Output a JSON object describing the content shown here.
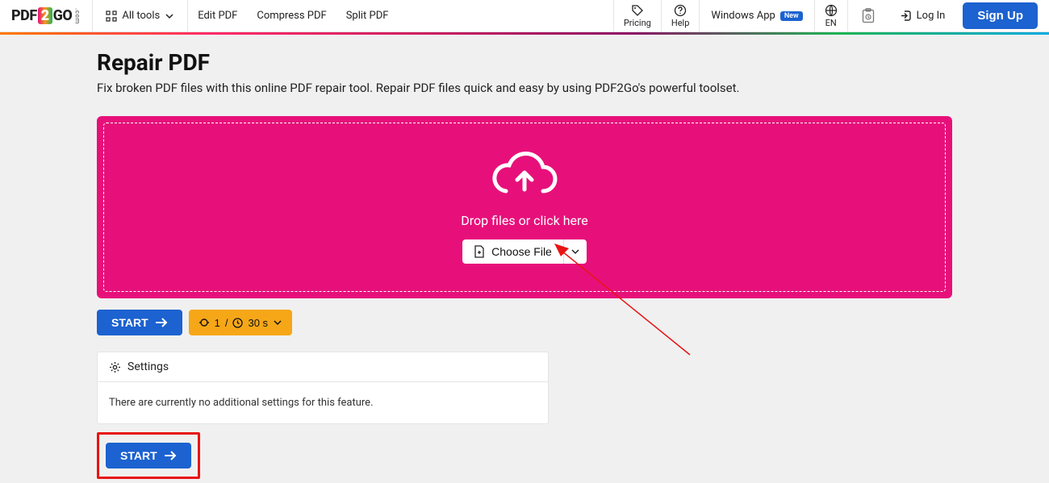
{
  "nav": {
    "logo_pdf": "PDF",
    "logo_two": "2",
    "logo_go": "GO",
    "logo_com": ".com",
    "all_tools": "All tools",
    "edit": "Edit PDF",
    "compress": "Compress PDF",
    "split": "Split PDF",
    "pricing": "Pricing",
    "help": "Help",
    "windows_app": "Windows App",
    "badge_new": "New",
    "lang": "EN",
    "login": "Log In",
    "signup": "Sign Up"
  },
  "page": {
    "title": "Repair PDF",
    "subtitle": "Fix broken PDF files with this online PDF repair tool. Repair PDF files quick and easy by using PDF2Go's powerful toolset."
  },
  "dropzone": {
    "text": "Drop files or click here",
    "choose": "Choose File"
  },
  "buttons": {
    "start": "START",
    "timer_count": "1",
    "timer_sep": "/",
    "timer_value": "30 s"
  },
  "settings": {
    "label": "Settings",
    "body": "There are currently no additional settings for this feature."
  }
}
